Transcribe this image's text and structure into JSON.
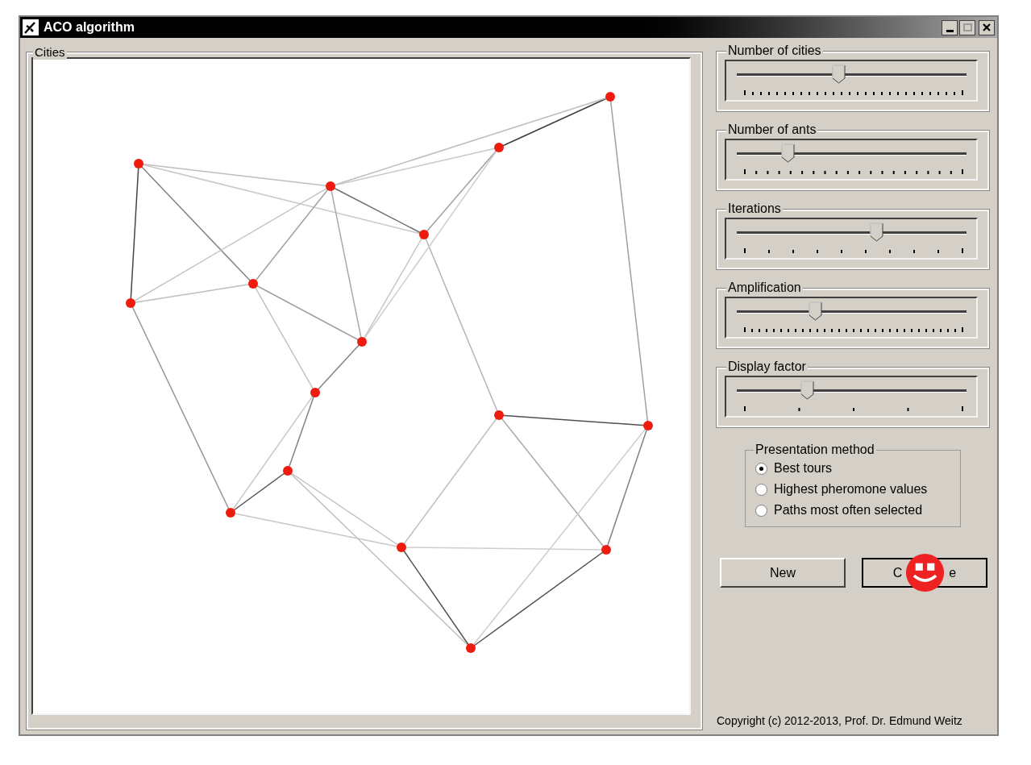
{
  "window": {
    "title": "ACO algorithm"
  },
  "cities_panel": {
    "title": "Cities"
  },
  "sliders": [
    {
      "label": "Number of cities",
      "level": 0.445
    },
    {
      "label": "Number of ants",
      "level": 0.226
    },
    {
      "label": "Iterations",
      "level": 0.61
    },
    {
      "label": "Amplification",
      "level": 0.343
    },
    {
      "label": "Display factor",
      "level": 0.31
    }
  ],
  "presentation_method": {
    "title": "Presentation method",
    "options": [
      {
        "label": "Best tours",
        "selected": true
      },
      {
        "label": "Highest pheromone values",
        "selected": false
      },
      {
        "label": "Paths most often selected",
        "selected": false
      }
    ]
  },
  "buttons": [
    {
      "label": "New"
    },
    {
      "label": "C",
      "label_end": "e"
    }
  ],
  "copyright": "Copyright (c) 2012-2013, Prof. Dr. Edmund Weitz"
}
